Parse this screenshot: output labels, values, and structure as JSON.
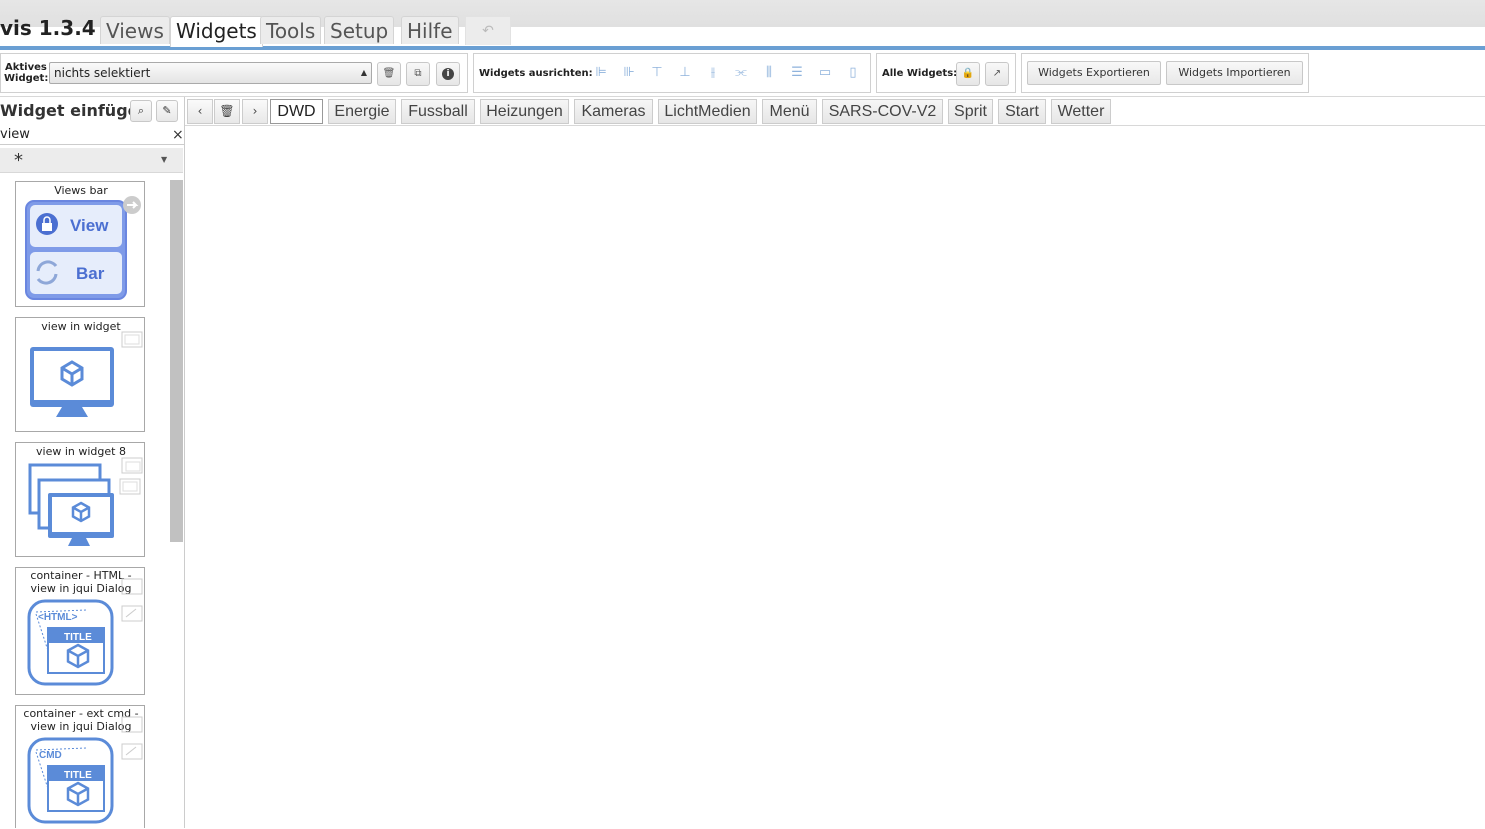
{
  "app": {
    "title": "vis 1.3.4"
  },
  "main_tabs": [
    {
      "label": "Views",
      "active": false
    },
    {
      "label": "Widgets",
      "active": true
    },
    {
      "label": "Tools",
      "active": false
    },
    {
      "label": "Setup",
      "active": false
    },
    {
      "label": "Hilfe",
      "active": false
    }
  ],
  "undo": {
    "icon": "undo-icon"
  },
  "toolbar": {
    "active_widget_label_1": "Aktives",
    "active_widget_label_2": "Widget:",
    "active_widget_value": "nichts selektiert",
    "align_label": "Widgets ausrichten:",
    "all_widgets_label": "Alle Widgets:",
    "export_label": "Widgets Exportieren",
    "import_label": "Widgets Importieren"
  },
  "widget_panel": {
    "title": "Widget einfügen",
    "filter_value": "view",
    "set_value": "*",
    "widgets": [
      {
        "title": "Views bar",
        "icon_view": "View",
        "icon_bar": "Bar"
      },
      {
        "title": "view in widget"
      },
      {
        "title": "view in widget 8"
      },
      {
        "title_1": "container - HTML -",
        "title_2": "view in jqui Dialog",
        "icon_tag": "<HTML>",
        "icon_title": "TITLE"
      },
      {
        "title_1": "container - ext cmd -",
        "title_2": "view in jqui Dialog",
        "icon_tag": "CMD",
        "icon_title": "TITLE"
      }
    ]
  },
  "view_tabs": [
    {
      "label": "DWD",
      "active": true
    },
    {
      "label": "Energie",
      "active": false
    },
    {
      "label": "Fussball",
      "active": false
    },
    {
      "label": "Heizungen",
      "active": false
    },
    {
      "label": "Kameras",
      "active": false
    },
    {
      "label": "LichtMedien",
      "active": false
    },
    {
      "label": "Menü",
      "active": false
    },
    {
      "label": "SARS-COV-V2",
      "active": false
    },
    {
      "label": "Sprit",
      "active": false
    },
    {
      "label": "Start",
      "active": false
    },
    {
      "label": "Wetter",
      "active": false
    }
  ],
  "colors": {
    "accent": "#6a9fd3",
    "icon_blue": "#5b8bd8"
  }
}
